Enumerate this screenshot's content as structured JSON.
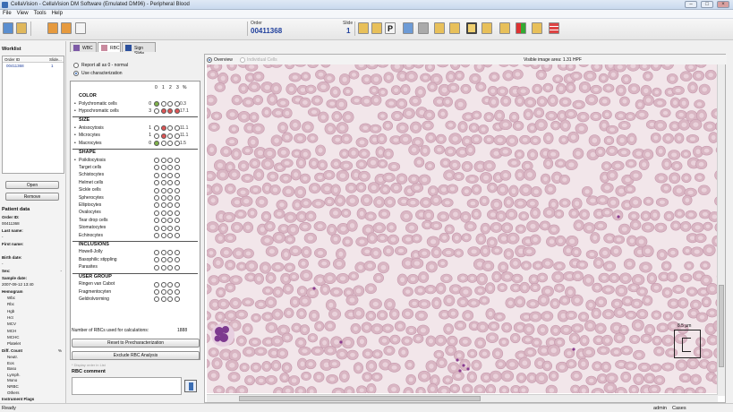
{
  "window": {
    "title": "CellaVision - CellaVision DM Software (Emulated DM96) - Peripheral Blood"
  },
  "menu": [
    "File",
    "View",
    "Tools",
    "Help"
  ],
  "info": {
    "order_label": "Order",
    "order_value": "00411368",
    "slide_label": "Slide",
    "slide_value": "1"
  },
  "worklist": {
    "title": "Worklist",
    "columns": [
      "Order ID",
      "Slide..."
    ],
    "rows": [
      {
        "order": "00411368",
        "slide": "1"
      }
    ],
    "open_label": "Open",
    "remove_label": "Remove"
  },
  "patient": {
    "title": "Patient data",
    "order_id_label": "Order ID:",
    "order_id": "00411368",
    "last_name_label": "Last name:",
    "last_name": "-",
    "first_name_label": "First name:",
    "birth_date_label": "Birth date:",
    "birth_date": "-",
    "sex_label": "Sex:",
    "sex": "-",
    "sample_date_label": "Sample date:",
    "sample_date": "2007-09-12 13:40",
    "hemogram_label": "Hemogram",
    "hemogram": [
      "Wbc",
      "Rbc",
      "Hgb",
      "Hct",
      "MCV",
      "MCH",
      "MCHC",
      "Platelet"
    ],
    "diff_label": "Diff. Count",
    "diff_unit": "%",
    "diff": [
      "Neutr.",
      "Eos",
      "Baso",
      "Lymph.",
      "Mono",
      "NRBC",
      "Others"
    ],
    "flags_label": "Instrument Flags"
  },
  "tabs": [
    "WBC",
    "RBC",
    "Sign Slide"
  ],
  "characterization": {
    "opt_normal": "Report all as 0 - normal",
    "opt_use": "Use characterization",
    "col_headers": [
      "0",
      "1",
      "2",
      "3",
      "%"
    ],
    "sections": [
      {
        "title": "COLOR",
        "rows": [
          {
            "name": "Polychromatic cells",
            "bullet": true,
            "count": "0",
            "pct": "0.3",
            "fill": [
              "#7fb24a",
              "",
              "",
              ""
            ]
          },
          {
            "name": "Hypochromatic cells",
            "bullet": true,
            "count": "3",
            "pct": "17.1",
            "fill": [
              "",
              "#d55",
              "#d55",
              "#d55"
            ]
          }
        ]
      },
      {
        "title": "SIZE",
        "rows": [
          {
            "name": "Anisocytosis",
            "bullet": true,
            "count": "1",
            "pct": "11.1",
            "fill": [
              "",
              "#d55",
              "",
              ""
            ]
          },
          {
            "name": "Microcytes",
            "bullet": true,
            "count": "1",
            "pct": "11.1",
            "fill": [
              "",
              "#d55",
              "",
              ""
            ]
          },
          {
            "name": "Macrocytes",
            "bullet": true,
            "count": "0",
            "pct": "1.5",
            "fill": [
              "#7fb24a",
              "",
              "",
              ""
            ]
          }
        ]
      },
      {
        "title": "SHAPE",
        "rows": [
          {
            "name": "Poikilocytosis",
            "bullet": true
          },
          {
            "name": "Target cells"
          },
          {
            "name": "Schistocytes"
          },
          {
            "name": "Helmet cells"
          },
          {
            "name": "Sickle cells"
          },
          {
            "name": "Spherocytes"
          },
          {
            "name": "Elliptocytes"
          },
          {
            "name": "Ovalocytes"
          },
          {
            "name": "Tear drop cells"
          },
          {
            "name": "Stomatocytes"
          },
          {
            "name": "Echinocytes"
          }
        ]
      },
      {
        "title": "INCLUSIONS",
        "rows": [
          {
            "name": "Howell-Jolly"
          },
          {
            "name": "Basophilic stippling"
          },
          {
            "name": "Parasites"
          }
        ]
      },
      {
        "title": "USER GROUP",
        "rows": [
          {
            "name": "Ringen van Cabot"
          },
          {
            "name": "Fragmentocyten"
          },
          {
            "name": "Geldrolvorming"
          }
        ]
      }
    ],
    "footnote": "* Display order in List",
    "rbc_count_label": "Number of RBCs used for calculations:",
    "rbc_count": "1888",
    "reset_label": "Reset to Precharacterization",
    "exclude_label": "Exclude RBC Analysis",
    "comment_label": "RBC comment"
  },
  "viewer": {
    "overview_label": "Overview",
    "individual_label": "Individual Cells",
    "visible_area": "Visible image area: 1.31 HPF",
    "scale_label": "8.5 µm"
  },
  "status": {
    "left": "Ready",
    "user": "admin",
    "cases": "Cases"
  },
  "colors": {
    "accent": "#1f3f9c",
    "rbc": "#d9b6c3",
    "rbc_center": "#ead2db",
    "background_smear": "#f2e6ea",
    "wbc": "#7d3a8f"
  }
}
